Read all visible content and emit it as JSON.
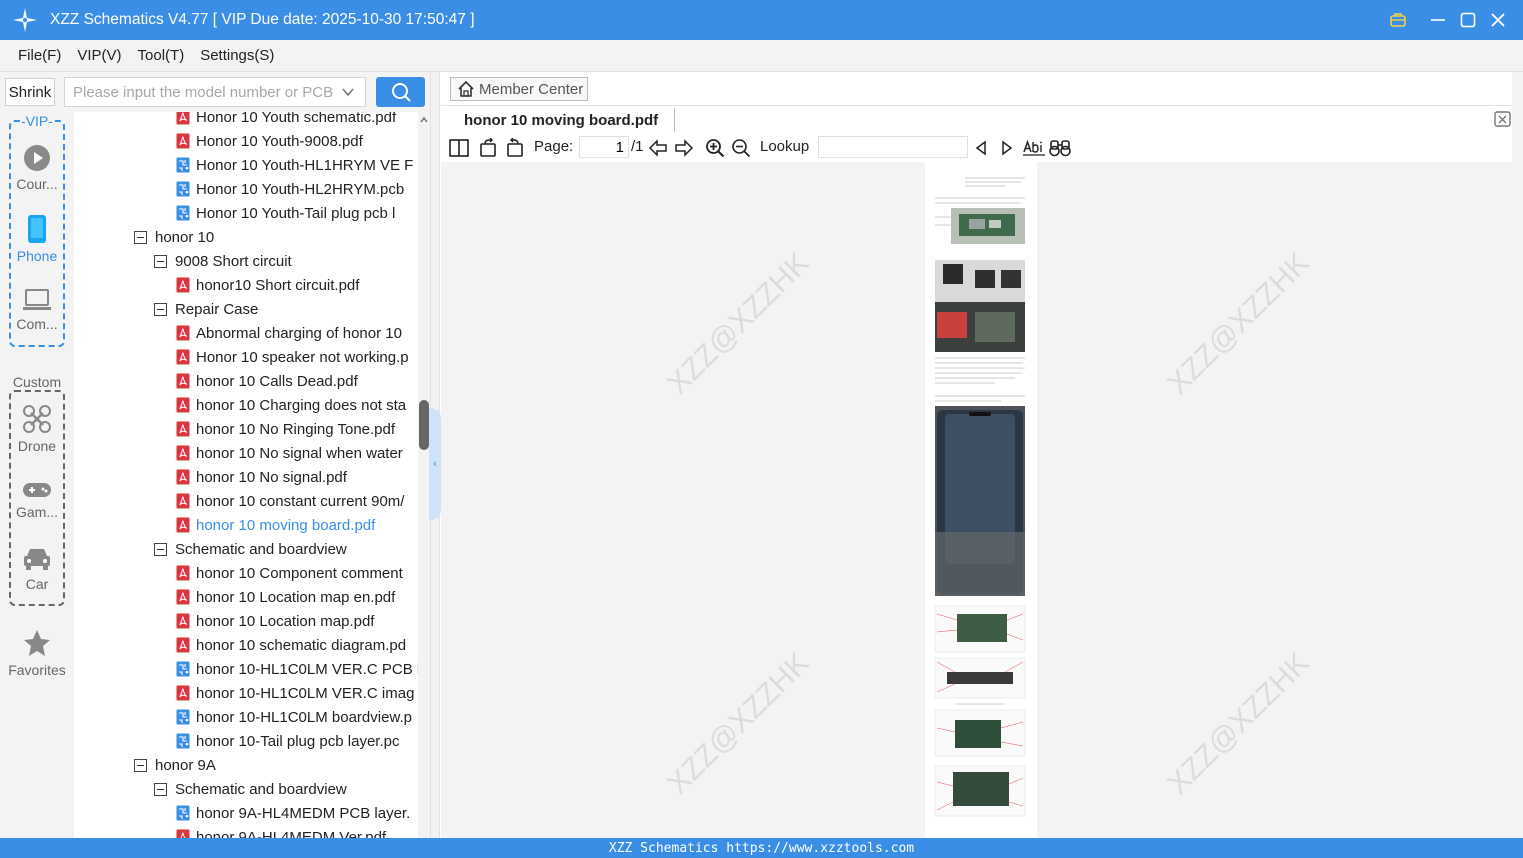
{
  "window": {
    "title": "XZZ Schematics V4.77 [ VIP Due date: 2025-10-30 17:50:47 ]"
  },
  "menu": [
    "File(F)",
    "VIP(V)",
    "Tool(T)",
    "Settings(S)"
  ],
  "search": {
    "shrink_label": "Shrink",
    "placeholder": "Please input the model number or PCB"
  },
  "rail": {
    "vip_label": "-VIP-",
    "custom_label": "Custom",
    "items": [
      {
        "label": "Cour...",
        "icon": "play-circle-icon"
      },
      {
        "label": "Phone",
        "icon": "phone-icon"
      },
      {
        "label": "Com...",
        "icon": "laptop-icon"
      },
      {
        "label": "Drone",
        "icon": "drone-icon"
      },
      {
        "label": "Gam...",
        "icon": "gamepad-icon"
      },
      {
        "label": "Car",
        "icon": "car-icon"
      },
      {
        "label": "Favorites",
        "icon": "star-icon"
      }
    ]
  },
  "tree": [
    {
      "level": 2,
      "type": "pdf",
      "text": "Honor 10 Youth schematic.pdf"
    },
    {
      "level": 2,
      "type": "pdf",
      "text": "Honor 10 Youth-9008.pdf"
    },
    {
      "level": 2,
      "type": "pcb",
      "text": "Honor 10 Youth-HL1HRYM VE F"
    },
    {
      "level": 2,
      "type": "pcb",
      "text": "Honor 10 Youth-HL2HRYM.pcb"
    },
    {
      "level": 2,
      "type": "pcb",
      "text": "Honor 10 Youth-Tail plug pcb l"
    },
    {
      "level": 0,
      "type": "folder",
      "text": "honor 10"
    },
    {
      "level": 1,
      "type": "folder",
      "text": "9008 Short circuit"
    },
    {
      "level": 2,
      "type": "pdf",
      "text": "honor10 Short circuit.pdf"
    },
    {
      "level": 1,
      "type": "folder",
      "text": "Repair Case"
    },
    {
      "level": 2,
      "type": "pdf",
      "text": "Abnormal charging of honor 10"
    },
    {
      "level": 2,
      "type": "pdf",
      "text": "Honor 10 speaker not working.p"
    },
    {
      "level": 2,
      "type": "pdf",
      "text": "honor 10 Calls Dead.pdf"
    },
    {
      "level": 2,
      "type": "pdf",
      "text": "honor 10 Charging does not sta"
    },
    {
      "level": 2,
      "type": "pdf",
      "text": "honor 10 No Ringing Tone.pdf"
    },
    {
      "level": 2,
      "type": "pdf",
      "text": "honor 10 No signal when water"
    },
    {
      "level": 2,
      "type": "pdf",
      "text": "honor 10 No signal.pdf"
    },
    {
      "level": 2,
      "type": "pdf",
      "text": "honor 10 constant current 90m/"
    },
    {
      "level": 2,
      "type": "pdf",
      "text": "honor 10 moving board.pdf",
      "selected": true
    },
    {
      "level": 1,
      "type": "folder",
      "text": "Schematic and boardview"
    },
    {
      "level": 2,
      "type": "pdf",
      "text": "honor 10 Component comment"
    },
    {
      "level": 2,
      "type": "pdf",
      "text": "honor 10 Location map en.pdf"
    },
    {
      "level": 2,
      "type": "pdf",
      "text": "honor 10 Location map.pdf"
    },
    {
      "level": 2,
      "type": "pdf",
      "text": "honor 10 schematic diagram.pd"
    },
    {
      "level": 2,
      "type": "pcb",
      "text": "honor 10-HL1C0LM VER.C PCB l"
    },
    {
      "level": 2,
      "type": "pdf",
      "text": "honor 10-HL1C0LM VER.C imag"
    },
    {
      "level": 2,
      "type": "pcb",
      "text": "honor 10-HL1C0LM boardview.p"
    },
    {
      "level": 2,
      "type": "pcb",
      "text": "honor 10-Tail plug pcb layer.pc"
    },
    {
      "level": 0,
      "type": "folder",
      "text": "honor 9A"
    },
    {
      "level": 1,
      "type": "folder",
      "text": "Schematic and boardview"
    },
    {
      "level": 2,
      "type": "pcb",
      "text": "honor 9A-HL4MEDM PCB layer."
    },
    {
      "level": 2,
      "type": "pdf",
      "text": "honor 9A-HL4MEDM Ver.pdf"
    }
  ],
  "viewer": {
    "member_center_label": "Member Center",
    "tab_title": "honor 10 moving board.pdf",
    "page_label": "Page:",
    "page_current": "1",
    "page_total": "/1",
    "lookup_label": "Lookup",
    "watermark": "XZZ@XZZHK"
  },
  "status": {
    "text": "XZZ Schematics https://www.xzztools.com"
  },
  "colors": {
    "accent": "#3a8ee6",
    "pdf_icon": "#d9363e",
    "pcb_icon": "#3a8ee6"
  }
}
